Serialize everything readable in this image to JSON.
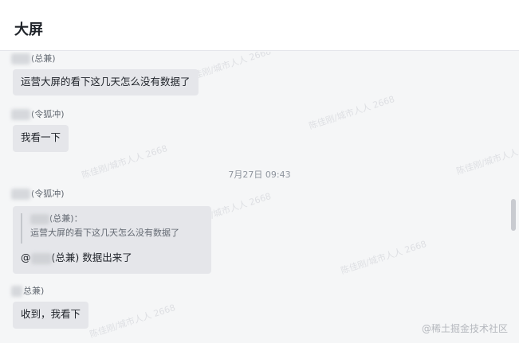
{
  "header": {
    "title": "大屏"
  },
  "messages": [
    {
      "sender_suffix": "(总兼)",
      "text": "运营大屏的看下这几天怎么没有数据了"
    },
    {
      "sender_suffix": "(令狐冲)",
      "text": "我看一下"
    }
  ],
  "timestamp": "7月27日 09:43",
  "reply_message": {
    "sender_suffix": "(令狐冲)",
    "quote_author_suffix": "(总兼)：",
    "quote_text": "运营大屏的看下这几天怎么没有数据了",
    "mention_prefix": "@",
    "mention_suffix": "(总兼)",
    "text": "数据出来了"
  },
  "last_message": {
    "sender_suffix": "总兼)",
    "text": "收到，我看下"
  },
  "watermark_text": "陈佳刚/城市人人 2668",
  "brand_mark": "@稀土掘金技术社区"
}
